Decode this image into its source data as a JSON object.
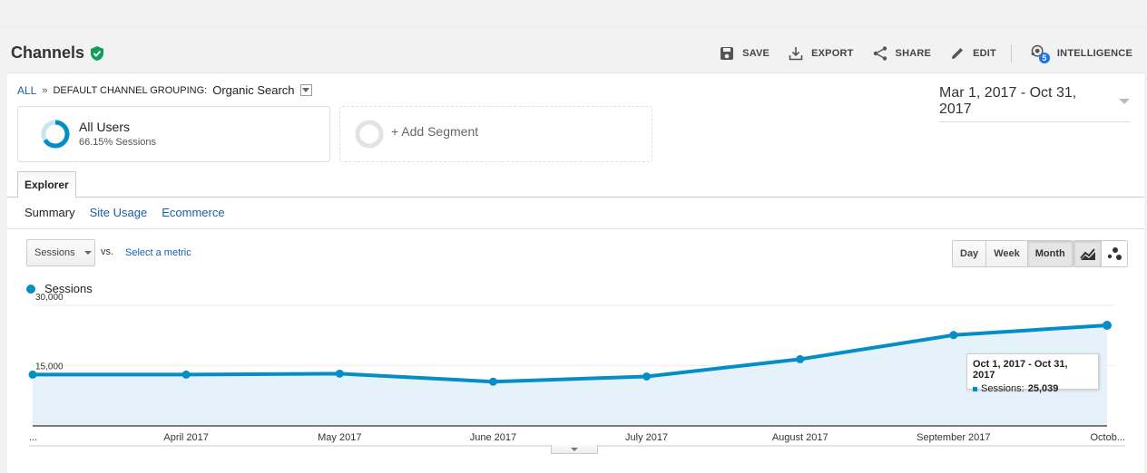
{
  "header": {
    "title": "Channels",
    "title_badge": "verified-shield-icon",
    "actions": [
      {
        "label": "SAVE",
        "icon": "save-icon"
      },
      {
        "label": "EXPORT",
        "icon": "download-icon"
      },
      {
        "label": "SHARE",
        "icon": "share-icon"
      },
      {
        "label": "EDIT",
        "icon": "pencil-icon"
      },
      {
        "label": "INTELLIGENCE",
        "icon": "intelligence-icon",
        "badge": "5"
      }
    ]
  },
  "breadcrumb": {
    "root": "ALL",
    "separator": "»",
    "key": "DEFAULT CHANNEL GROUPING:",
    "value": "Organic Search"
  },
  "date_range": "Mar 1, 2017 - Oct 31, 2017",
  "segments": {
    "active": {
      "name": "All Users",
      "sub": "66.15% Sessions",
      "share": 0.6615
    },
    "add_label": "+ Add Segment"
  },
  "tabs": {
    "explorer": "Explorer"
  },
  "subtabs": [
    {
      "label": "Summary",
      "active": true
    },
    {
      "label": "Site Usage",
      "active": false
    },
    {
      "label": "Ecommerce",
      "active": false
    }
  ],
  "metric": {
    "selected": "Sessions",
    "vs": "vs.",
    "select_metric": "Select a metric"
  },
  "period_buttons": [
    {
      "label": "Day",
      "active": false
    },
    {
      "label": "Week",
      "active": false
    },
    {
      "label": "Month",
      "active": true
    }
  ],
  "chart_type_buttons": [
    {
      "icon": "line-chart-icon",
      "active": true
    },
    {
      "icon": "motion-chart-icon",
      "active": false
    }
  ],
  "colors": {
    "series": "#058dc7",
    "area": "#e6f2f9",
    "link": "#1a5fa8",
    "verified": "#0f9d58"
  },
  "chart_data": {
    "type": "area",
    "title": "",
    "legend": [
      "Sessions"
    ],
    "legend_position": "top-left",
    "x": [
      "...",
      "April 2017",
      "May 2017",
      "June 2017",
      "July 2017",
      "August 2017",
      "September 2017",
      "Octob..."
    ],
    "series": [
      {
        "name": "Sessions",
        "values": [
          12770,
          12770,
          13000,
          11000,
          12300,
          16600,
          22600,
          25039
        ]
      }
    ],
    "yticks": [
      15000,
      30000
    ],
    "ytick_labels": [
      "15,000",
      "30,000"
    ],
    "ylim": [
      0,
      30000
    ],
    "grid": true,
    "tooltip": {
      "title": "Oct 1, 2017 - Oct 31, 2017",
      "label": "Sessions:",
      "value": "25,039",
      "point_index": 7
    }
  }
}
